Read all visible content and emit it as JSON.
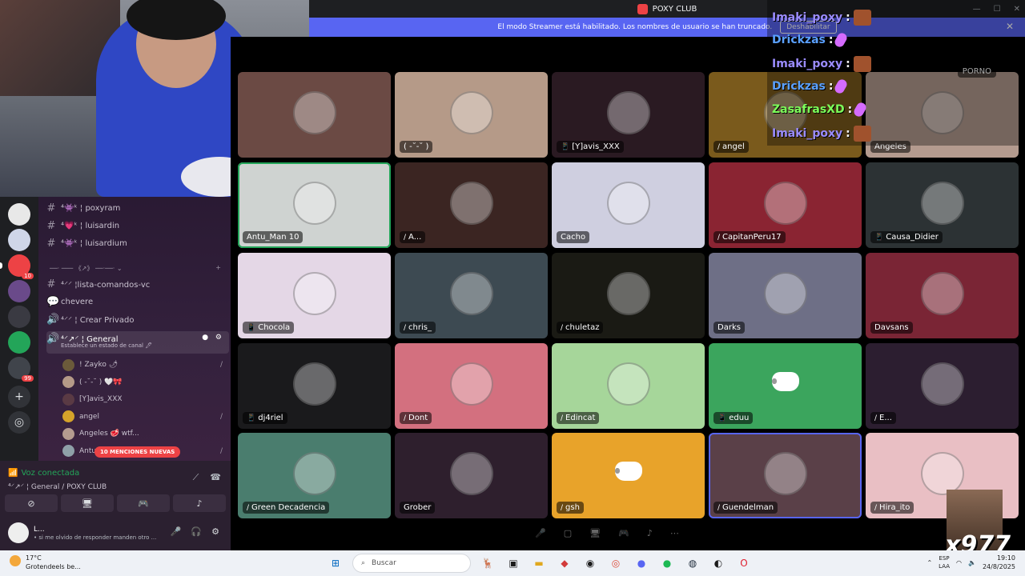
{
  "window": {
    "title": "POXY CLUB"
  },
  "banner": {
    "message": "El modo Streamer está habilitado. Los nombres de usuario se han truncado.",
    "button": "Deshabilitar"
  },
  "chat_overlay": [
    {
      "user": "Imaki_poxy",
      "color": "#9b8cff"
    },
    {
      "user": "Drickzas",
      "color": "#5aa0ff"
    },
    {
      "user": "Imaki_poxy",
      "color": "#9b8cff"
    },
    {
      "user": "Drickzas",
      "color": "#5aa0ff"
    },
    {
      "user": "ZasafrasXD",
      "color": "#7dff5a"
    },
    {
      "user": "Imaki_poxy",
      "color": "#9b8cff"
    }
  ],
  "tiles": [
    {
      "name": "",
      "bg": "#6b4a44"
    },
    {
      "name": "( -˘-˘ )",
      "bg": "#b59a88"
    },
    {
      "name": "[Y]avis_XXX",
      "bg": "#2a1a22",
      "icon": "📱"
    },
    {
      "name": "angel",
      "bg": "#7a5a1c",
      "icon": "∕"
    },
    {
      "name": "Angeles",
      "bg": "#b49b8f"
    },
    {
      "name": "Antu_Man 10",
      "bg": "#cfd3d1"
    },
    {
      "name": "A...",
      "bg": "#3b2522",
      "icon": "∕"
    },
    {
      "name": "Cacho",
      "bg": "#cfcfe0"
    },
    {
      "name": "CapitanPeru17",
      "bg": "#8a2432",
      "icon": "∕"
    },
    {
      "name": "Causa_Didier",
      "bg": "#2c3234",
      "icon": "📱"
    },
    {
      "name": "Chocola",
      "bg": "#e4d7e6",
      "icon": "📱"
    },
    {
      "name": "chris_",
      "bg": "#3d4a52",
      "icon": "∕"
    },
    {
      "name": "chuletaz",
      "bg": "#1a1a14",
      "icon": "∕"
    },
    {
      "name": "Darks",
      "bg": "#6e6f86"
    },
    {
      "name": "Davsans",
      "bg": "#7a2535"
    },
    {
      "name": "dj4riel",
      "bg": "#1a1a1c",
      "icon": "📱"
    },
    {
      "name": "Dont",
      "bg": "#d3707f",
      "icon": "∕"
    },
    {
      "name": "Edincat",
      "bg": "#a6d69a",
      "icon": "∕"
    },
    {
      "name": "eduu",
      "bg": "#3ba55d",
      "icon": "📱",
      "discord": true
    },
    {
      "name": "E...",
      "bg": "#2c1e30",
      "icon": "∕"
    },
    {
      "name": "Green Decadencia",
      "bg": "#4a7d6e",
      "icon": "∕"
    },
    {
      "name": "Grober",
      "bg": "#2e1f2d"
    },
    {
      "name": "gsh",
      "bg": "#e8a32a",
      "icon": "∕",
      "discord": true
    },
    {
      "name": "Guendelman",
      "bg": "#5a4048",
      "icon": "∕"
    },
    {
      "name": "Hira_ito",
      "bg": "#e9bfc4",
      "icon": "∕"
    }
  ],
  "porno_label": "PORNO",
  "sidebar": {
    "channels": [
      {
        "prefix": "#",
        "label": "⁴👾ᵏ ¦ poxyram"
      },
      {
        "prefix": "#",
        "label": "⁴💗ᵏ ¦ luisardin"
      },
      {
        "prefix": "#",
        "label": "⁴👾ᵏ ¦ luisardium"
      }
    ],
    "category": "──· ─── 《↗》 ──·──· ⌄",
    "voice_channels": [
      {
        "prefix": "#",
        "label": "⁴⸍⸍ ¦lista-comandos-vc"
      },
      {
        "prefix": "💬",
        "label": "chevere"
      },
      {
        "prefix": "🔊",
        "label": "⁴⸍⸍ ¦ Crear Privado"
      }
    ],
    "active_channel": {
      "label": "⁴⸍↗⸍ ¦ General",
      "subtitle": "Establece un estado de canal 🖊"
    },
    "members": [
      {
        "name": "! Zayko 🌶",
        "color": "#6b5a3a",
        "muted": true
      },
      {
        "name": "( -˘-˘ )  🤍🎀",
        "color": "#b59a88"
      },
      {
        "name": "[Y]avis_XXX",
        "color": "#5a3a44"
      },
      {
        "name": "angel",
        "color": "#d6a32a",
        "muted": true
      },
      {
        "name": "Angeles  🥩 wtf...",
        "color": "#b49b8f"
      },
      {
        "name": "Antu",
        "color": "#8fa0a8",
        "muted": true
      }
    ],
    "mentions_badge": "10 MENCIONES NUEVAS"
  },
  "rail": {
    "servers": [
      {
        "color": "#e8e8e8"
      },
      {
        "color": "#cfd6e8"
      },
      {
        "color": "#ed4245",
        "badge": "10"
      },
      {
        "color": "#6a4a8a"
      },
      {
        "color": "#3a3a42"
      },
      {
        "color": "#23a559"
      },
      {
        "color": "#40444b",
        "badge": "99"
      }
    ],
    "add_icon": "+",
    "discover_icon": "◎"
  },
  "voice": {
    "status": "Voz conectada",
    "channel": "⁴⸍↗⸍ ¦ General / POXY CLUB",
    "user_name": "L...",
    "user_status": "• si me olvido de responder manden otro ..."
  },
  "taskbar": {
    "weather_temp": "17°C",
    "weather_desc": "Grotendeels be...",
    "search_placeholder": "Buscar",
    "lang_top": "ESP",
    "lang_bottom": "LAA",
    "time": "19:10",
    "date": "24/8/2025"
  },
  "meme_text": "x977"
}
